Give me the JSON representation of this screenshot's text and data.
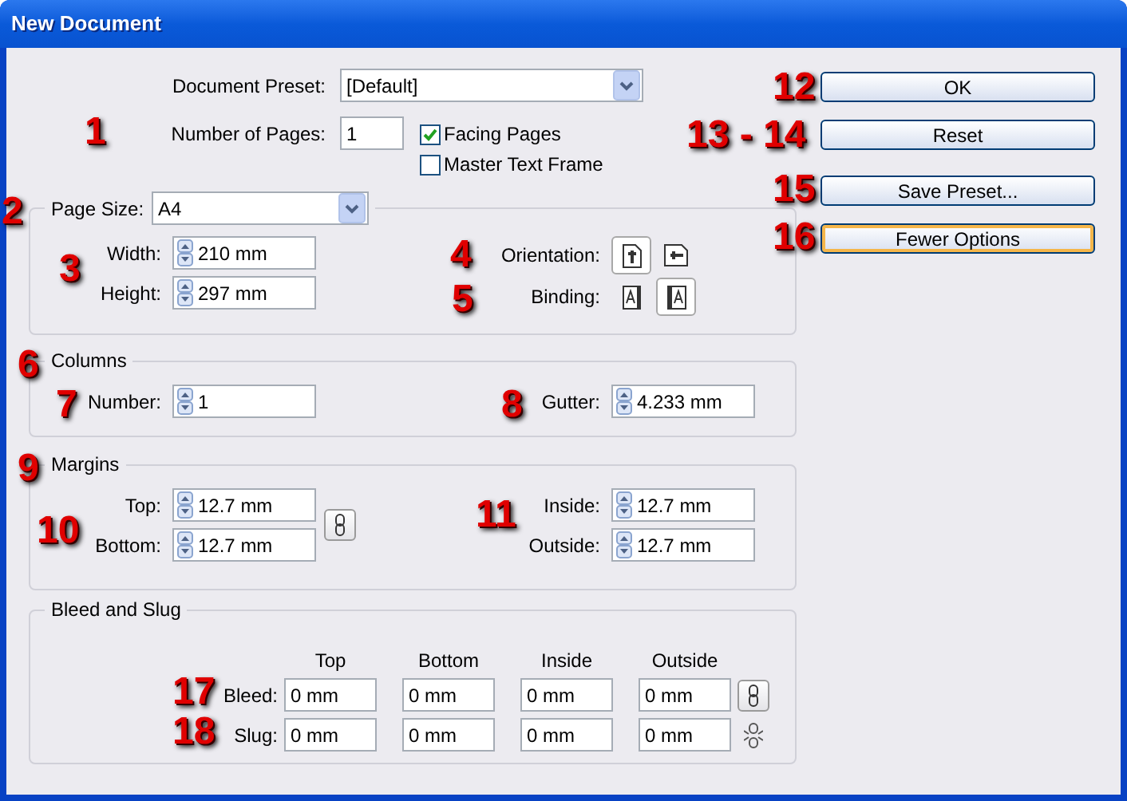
{
  "window": {
    "title": "New Document"
  },
  "document_preset": {
    "label": "Document Preset:",
    "value": "[Default]"
  },
  "number_of_pages": {
    "label": "Number of Pages:",
    "value": "1"
  },
  "checkboxes": [
    {
      "label": "Facing Pages",
      "checked": true
    },
    {
      "label": "Master Text Frame",
      "checked": false
    }
  ],
  "page_size": {
    "label": "Page Size:",
    "value": "A4",
    "fields": [
      {
        "label": "Width:",
        "value": "210 mm"
      },
      {
        "label": "Height:",
        "value": "297 mm"
      }
    ],
    "orientation": {
      "label": "Orientation:",
      "options": [
        {
          "kind": "portrait",
          "selected": true
        },
        {
          "kind": "landscape",
          "selected": false
        }
      ]
    },
    "binding": {
      "label": "Binding:",
      "options": [
        {
          "kind": "left",
          "selected": false
        },
        {
          "kind": "right",
          "selected": true
        }
      ]
    }
  },
  "columns": {
    "title": "Columns",
    "number": {
      "label": "Number:",
      "value": "1"
    },
    "gutter": {
      "label": "Gutter:",
      "value": "4.233 mm"
    }
  },
  "margins": {
    "title": "Margins",
    "left": [
      {
        "label": "Top:",
        "value": "12.7 mm"
      },
      {
        "label": "Bottom:",
        "value": "12.7 mm"
      }
    ],
    "right": [
      {
        "label": "Inside:",
        "value": "12.7 mm"
      },
      {
        "label": "Outside:",
        "value": "12.7 mm"
      }
    ]
  },
  "bleed_and_slug": {
    "title": "Bleed and Slug",
    "headers": [
      "Top",
      "Bottom",
      "Inside",
      "Outside"
    ],
    "rows": [
      {
        "label": "Bleed:",
        "kind": "linked",
        "values": [
          "0 mm",
          "0 mm",
          "0 mm",
          "0 mm"
        ]
      },
      {
        "label": "Slug:",
        "kind": "unlinked",
        "values": [
          "0 mm",
          "0 mm",
          "0 mm",
          "0 mm"
        ]
      }
    ]
  },
  "buttons": [
    {
      "label": "OK",
      "focused": false
    },
    {
      "label": "Reset",
      "focused": false
    },
    {
      "label": "Save Preset...",
      "focused": false
    },
    {
      "label": "Fewer Options",
      "focused": true
    }
  ],
  "annotations": [
    "1",
    "2",
    "3",
    "4",
    "5",
    "6",
    "7",
    "8",
    "9",
    "10",
    "11",
    "12",
    "13 - 14",
    "15",
    "16",
    "17",
    "18"
  ]
}
